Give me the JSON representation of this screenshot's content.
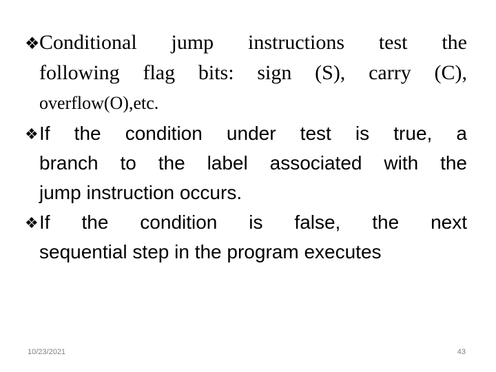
{
  "slide": {
    "background_color": "#ffffff",
    "text_color": "#000000",
    "bullet_glyph": "❖",
    "bullets": [
      {
        "marker": "❖",
        "style": "serif",
        "full_text": "Conditional jump instructions test the following flag bits: sign (S), carry (C), overflow(O),etc.",
        "lines": [
          "Conditional jump instructions test the",
          "following flag bits: sign (S), carry (C),",
          "overflow(O),etc."
        ]
      },
      {
        "marker": "❖",
        "style": "sans",
        "full_text": "If the condition under test is true, a branch to the label associated with the jump instruction occurs.",
        "lines": [
          "If the condition under test is true, a",
          "branch to the label associated with the",
          "jump instruction occurs."
        ]
      },
      {
        "marker": "❖",
        "style": "sans",
        "full_text": "If the condition is false, the next sequential step in the program executes",
        "lines": [
          "If the condition is false, the next",
          "sequential step in the program executes"
        ]
      }
    ]
  },
  "footer": {
    "date": "10/23/2021",
    "page_number": "43",
    "color": "#808080"
  }
}
